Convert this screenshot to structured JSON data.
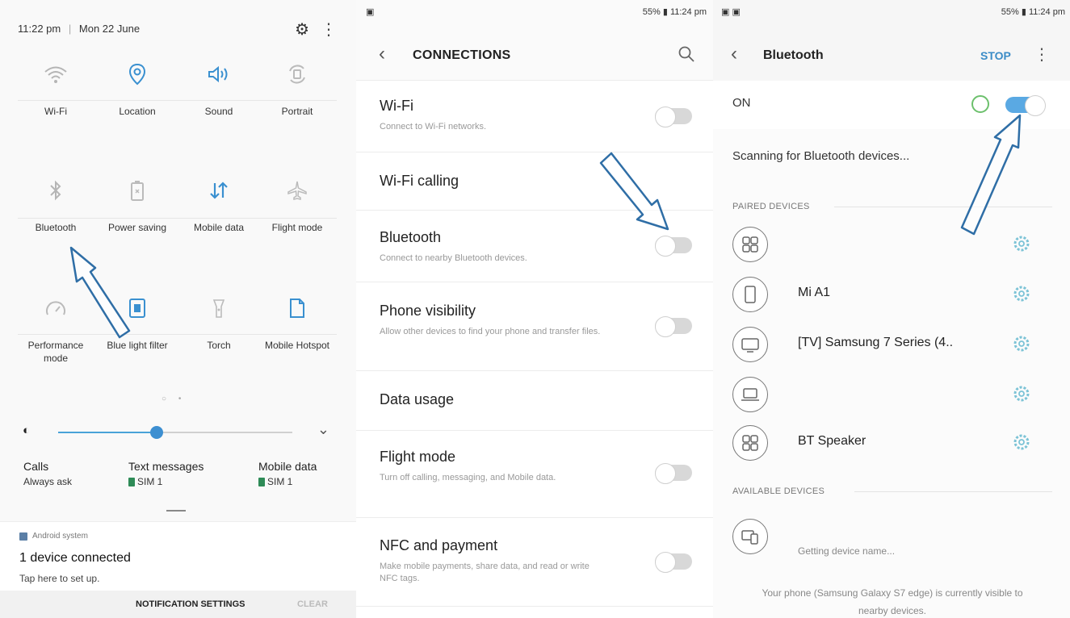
{
  "panel1": {
    "header": {
      "time": "11:22 pm",
      "separator": "|",
      "date": "Mon 22 June",
      "gear_icon": "gear-icon",
      "more_icon": "more-vert-icon"
    },
    "tiles": [
      {
        "label": "Wi-Fi",
        "icon": "wifi-icon"
      },
      {
        "label": "Location",
        "icon": "location-icon"
      },
      {
        "label": "Sound",
        "icon": "sound-icon"
      },
      {
        "label": "Portrait",
        "icon": "rotate-icon"
      },
      {
        "label": "Bluetooth",
        "icon": "bluetooth-icon"
      },
      {
        "label": "Power saving",
        "icon": "battery-icon"
      },
      {
        "label": "Mobile data",
        "icon": "mobile-data-icon"
      },
      {
        "label": "Flight mode",
        "icon": "airplane-icon"
      },
      {
        "label": "Performance mode",
        "icon": "speedometer-icon"
      },
      {
        "label": "Blue light filter",
        "icon": "blue-light-icon"
      },
      {
        "label": "Torch",
        "icon": "torch-icon"
      },
      {
        "label": "Mobile Hotspot",
        "icon": "hotspot-icon"
      }
    ],
    "pager": "○ •",
    "brightness_percent": 42,
    "sim": [
      {
        "title": "Calls",
        "value": "Always ask"
      },
      {
        "title": "Text messages",
        "value": "SIM 1"
      },
      {
        "title": "Mobile data",
        "value": "SIM 1"
      }
    ],
    "notification": {
      "source": "Android system",
      "title": "1 device connected",
      "subtitle": "Tap here to set up.",
      "settings_label": "NOTIFICATION SETTINGS",
      "clear_label": "CLEAR"
    }
  },
  "panel2": {
    "status_right": "55% ▮ 11:24 pm",
    "title": "CONNECTIONS",
    "rows": [
      {
        "title": "Wi-Fi",
        "desc": "Connect to Wi-Fi networks.",
        "toggle": false
      },
      {
        "title": "Wi-Fi calling",
        "desc": ""
      },
      {
        "title": "Bluetooth",
        "desc": "Connect to nearby Bluetooth devices.",
        "toggle": false
      },
      {
        "title": "Phone visibility",
        "desc": "Allow other devices to find your phone and transfer files.",
        "toggle": false
      },
      {
        "title": "Data usage",
        "desc": ""
      },
      {
        "title": "Flight mode",
        "desc": "Turn off calling, messaging, and Mobile data.",
        "toggle": false
      },
      {
        "title": "NFC and payment",
        "desc": "Make mobile payments, share data, and read or write NFC tags.",
        "toggle": false
      }
    ]
  },
  "panel3": {
    "status_right": "55% ▮ 11:24 pm",
    "title": "Bluetooth",
    "stop_label": "STOP",
    "on_label": "ON",
    "bluetooth_on": true,
    "scanning": "Scanning for Bluetooth devices...",
    "paired_header": "PAIRED DEVICES",
    "paired": [
      {
        "name": "",
        "icon": "grid-device-icon"
      },
      {
        "name": "Mi A1",
        "icon": "phone-icon"
      },
      {
        "name": "[TV] Samsung 7 Series (4..",
        "icon": "tv-icon"
      },
      {
        "name": "",
        "icon": "laptop-icon"
      },
      {
        "name": "BT Speaker",
        "icon": "grid-device-icon"
      }
    ],
    "available_header": "AVAILABLE DEVICES",
    "available_name": "Getting device name...",
    "footer": "Your phone (Samsung Galaxy S7 edge) is currently visible to nearby devices."
  }
}
